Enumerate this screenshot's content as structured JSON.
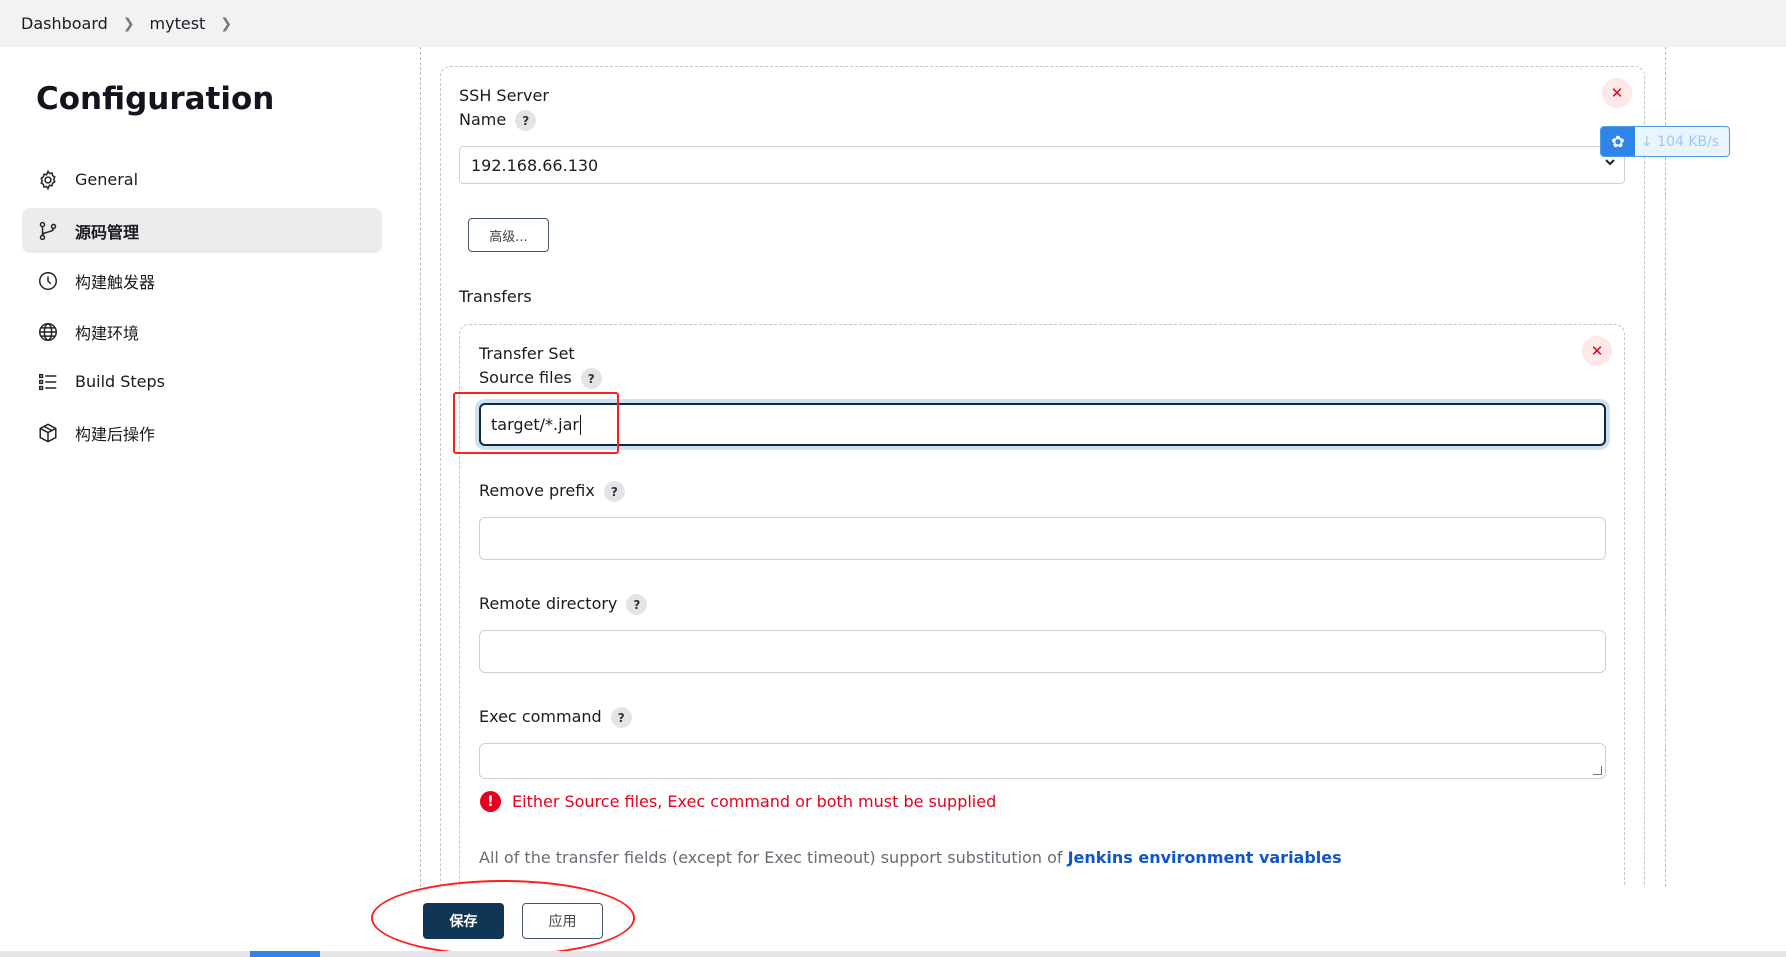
{
  "breadcrumb": {
    "items": [
      "Dashboard",
      "mytest"
    ],
    "separator": ">"
  },
  "sidebar": {
    "title": "Configuration",
    "items": [
      {
        "label": "General",
        "icon": "gear-icon"
      },
      {
        "label": "源码管理",
        "icon": "branch-icon",
        "active": true
      },
      {
        "label": "构建触发器",
        "icon": "clock-icon"
      },
      {
        "label": "构建环境",
        "icon": "globe-icon"
      },
      {
        "label": "Build Steps",
        "icon": "list-icon"
      },
      {
        "label": "构建后操作",
        "icon": "package-icon"
      }
    ]
  },
  "ssh": {
    "section_title": "SSH Server",
    "name_label": "Name",
    "help": "?",
    "name_value": "192.168.66.130",
    "advanced_label": "高级...",
    "close": "✕"
  },
  "transfers": {
    "title": "Transfers",
    "set_title": "Transfer Set",
    "source_files_label": "Source files",
    "source_files_value": "target/*.jar",
    "remove_prefix_label": "Remove prefix",
    "remove_prefix_value": "",
    "remote_directory_label": "Remote directory",
    "remote_directory_value": "",
    "exec_command_label": "Exec command",
    "exec_command_value": "",
    "error_icon": "!",
    "error_text": "Either Source files, Exec command or both must be supplied",
    "info_text": "All of the transfer fields (except for Exec timeout) support substitution of ",
    "info_link": "Jenkins environment variables"
  },
  "footer": {
    "save_label": "保存",
    "apply_label": "应用"
  },
  "net_widget": {
    "speed": "↓ 104 KB/s",
    "logo": "✿"
  },
  "colors": {
    "accent": "#113555",
    "error": "#e6001f",
    "link": "#1155cc",
    "annotation": "#ff1f1f"
  }
}
